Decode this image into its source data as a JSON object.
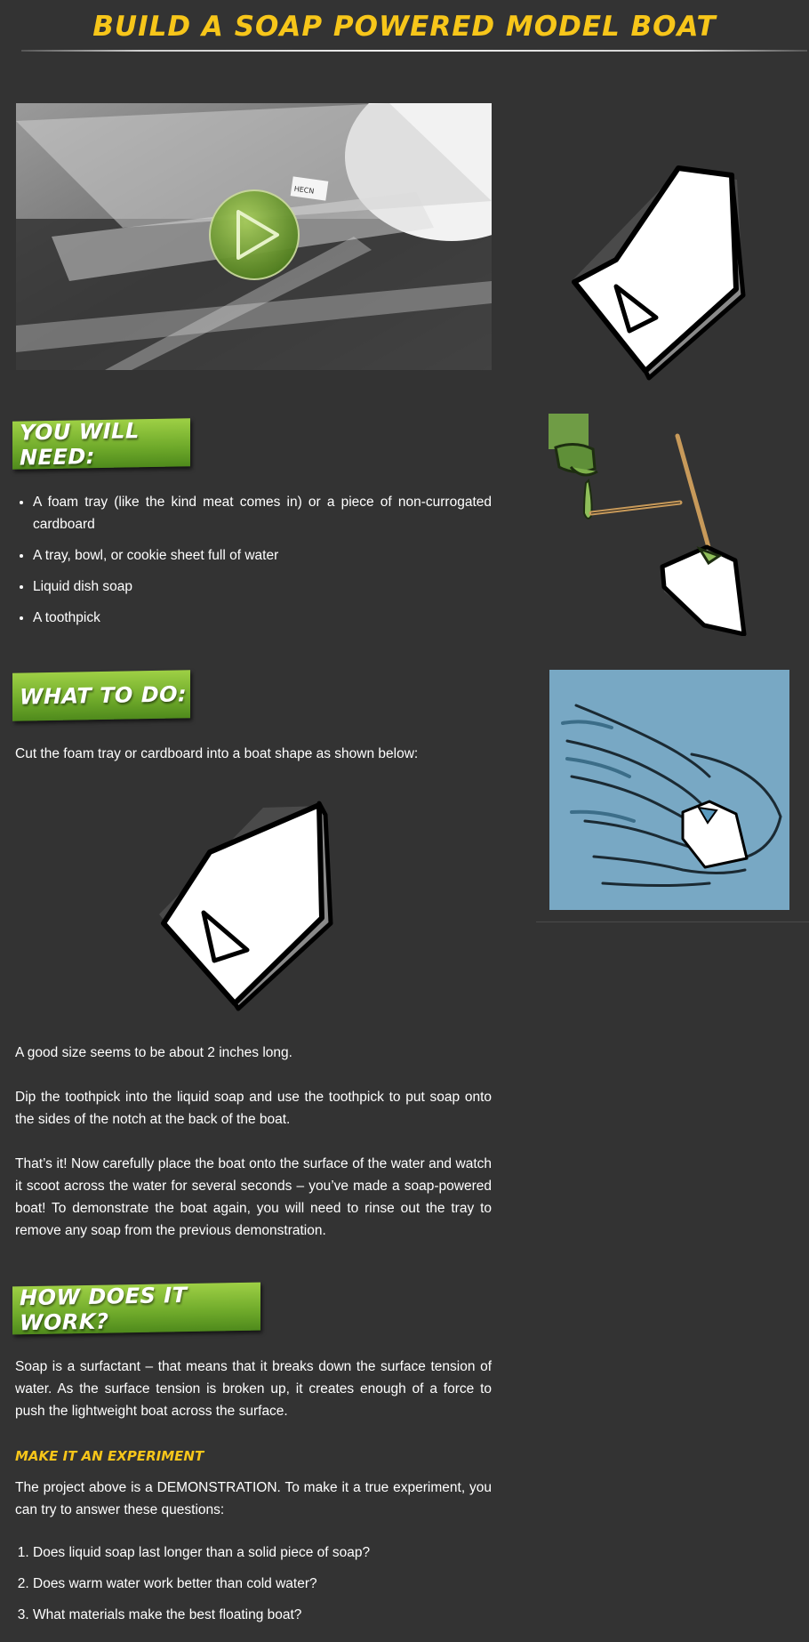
{
  "page": {
    "title": "BUILD A SOAP POWERED MODEL BOAT"
  },
  "video": {
    "play_icon": "play-icon",
    "label": "HECN"
  },
  "sections": {
    "need_heading": "YOU WILL NEED:",
    "do_heading": "WHAT TO DO:",
    "how_heading": "HOW DOES IT WORK?"
  },
  "needs": [
    "A foam tray (like the kind meat comes in) or a piece of non-currogated cardboard",
    "A tray, bowl, or cookie sheet full of water",
    "Liquid dish soap",
    "A toothpick"
  ],
  "steps": {
    "cut": "Cut the foam tray or cardboard into a boat shape as shown below:",
    "size": "A good size seems to be about 2 inches long.",
    "dip": "Dip the toothpick into the liquid soap and use the toothpick to put soap onto the sides of the notch at the back of the boat.",
    "done": "That’s it! Now carefully place the boat onto the surface of the water and watch it scoot across the water for several seconds – you’ve made a soap-powered boat! To demonstrate the boat again, you will need to rinse out the tray to remove any soap from the previous demonstration."
  },
  "how": {
    "text": "Soap is a surfactant – that means that it breaks down the surface tension of water.  As the surface tension is broken up, it creates enough of a force to push the lightweight boat across the surface."
  },
  "experiment": {
    "heading": "MAKE IT AN EXPERIMENT",
    "intro": "The project above is a DEMONSTRATION. To make it a true experiment, you can try to answer these questions:",
    "questions": [
      "Does liquid soap last longer than a solid piece of soap?",
      "Does warm water work better than cold water?",
      "What materials make the best floating boat?"
    ]
  },
  "colors": {
    "background": "#333333",
    "title_yellow": "#f7c61a",
    "banner_green": "#6ea92a",
    "water_blue": "#78a8c4"
  }
}
